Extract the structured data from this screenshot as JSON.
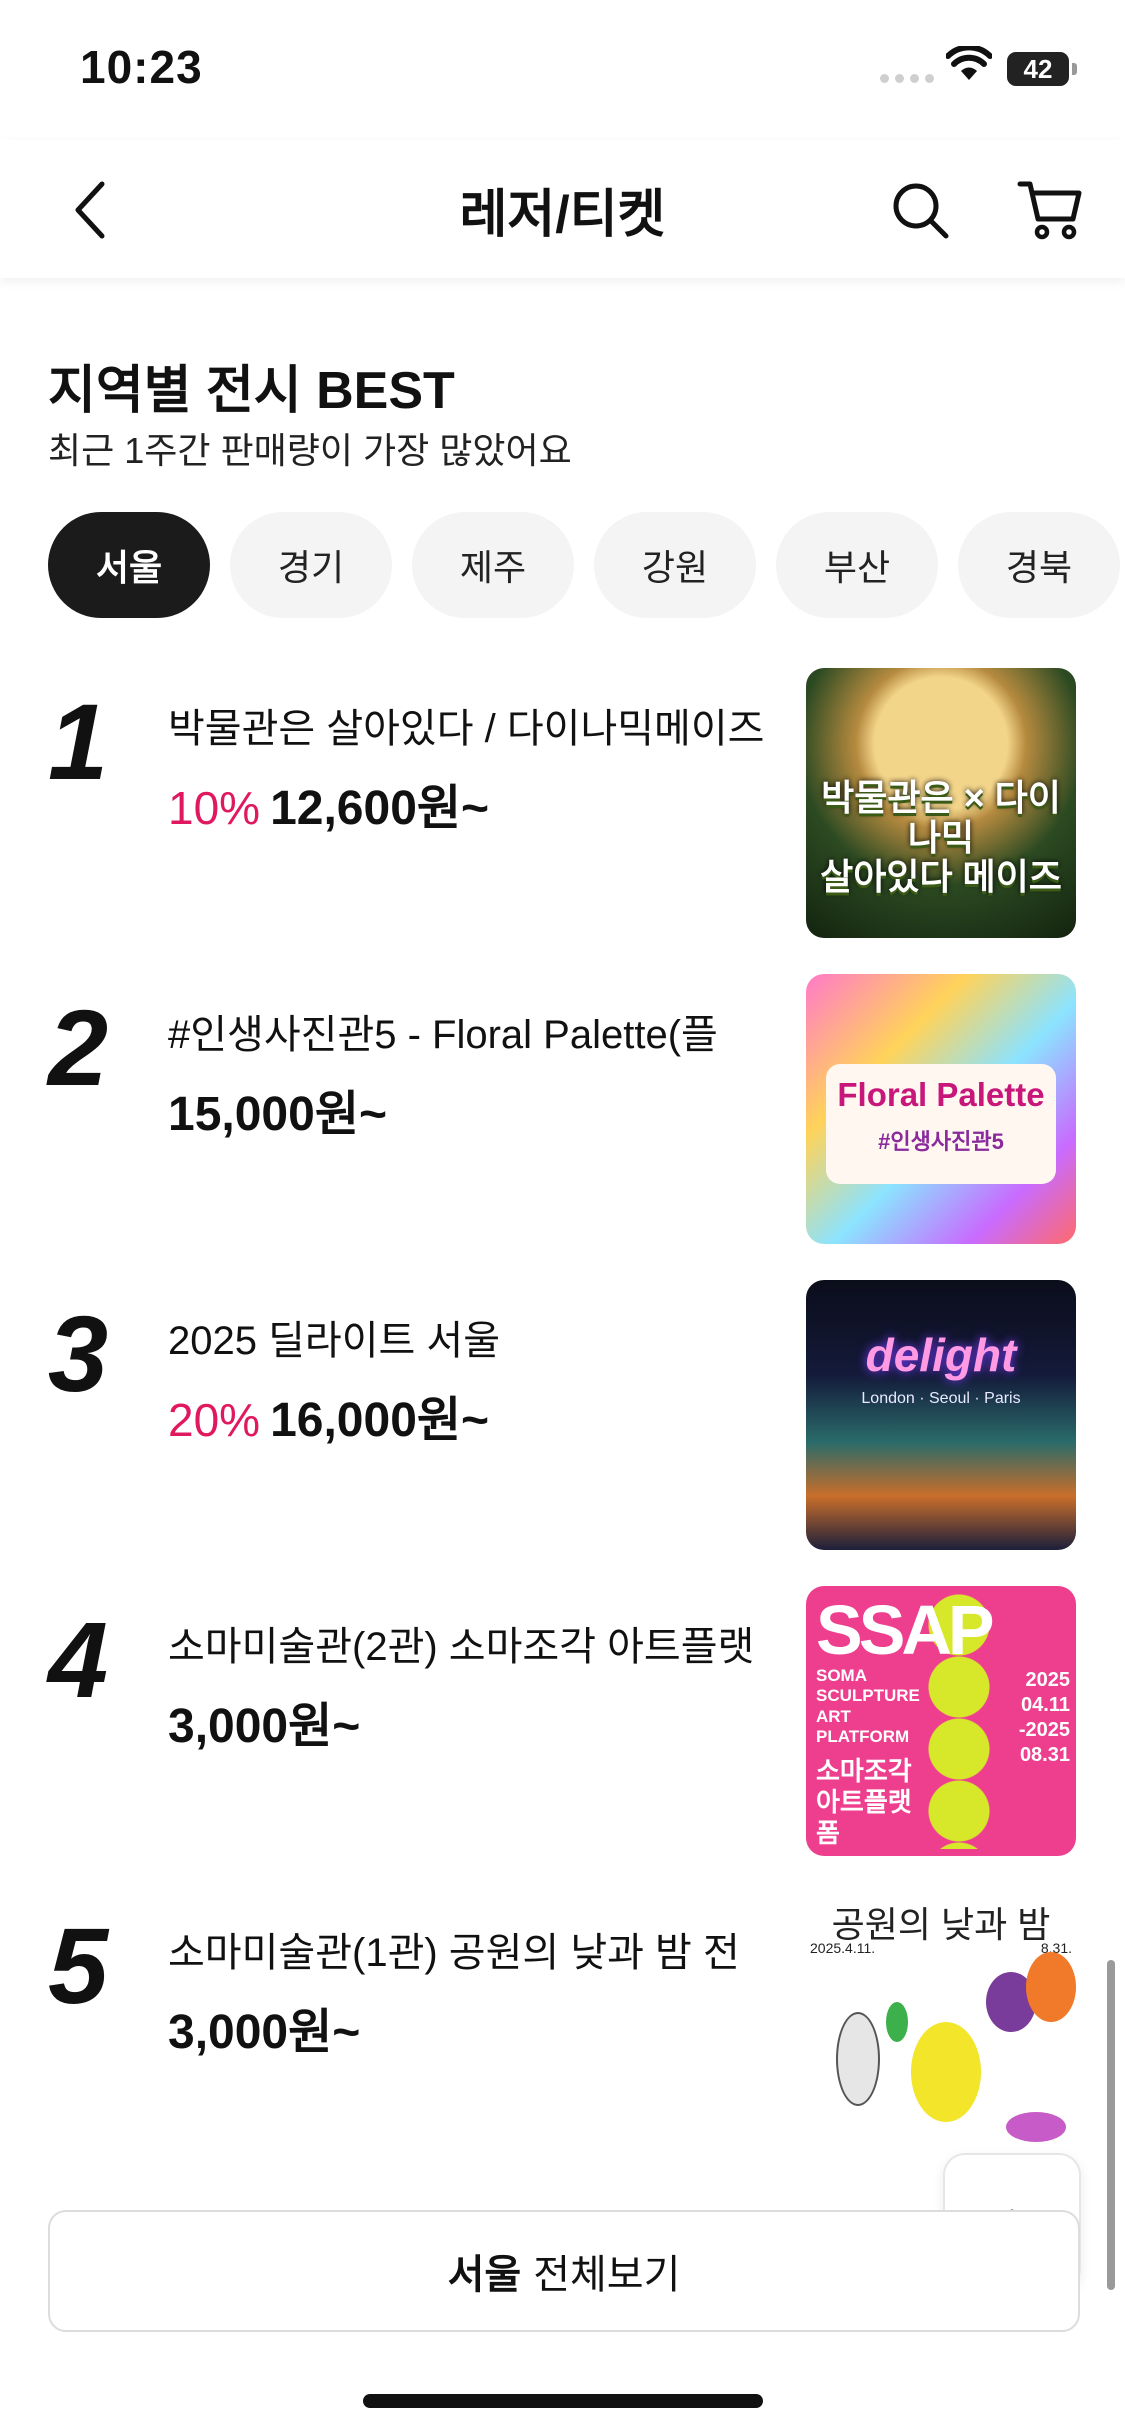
{
  "status_bar": {
    "time": "10:23",
    "battery": "42"
  },
  "navbar": {
    "title": "레저/티켓"
  },
  "section": {
    "title": "지역별 전시 BEST",
    "subtitle": "최근 1주간 판매량이 가장 많았어요"
  },
  "regions": [
    "서울",
    "경기",
    "제주",
    "강원",
    "부산",
    "경북"
  ],
  "active_region": "서울",
  "items": [
    {
      "rank": "1",
      "name": "박물관은 살아있다 / 다이나믹메이즈",
      "discount": "10%",
      "price": "12,600원~",
      "thumb_text": "박물관은 × 다이나믹\n살아있다 메이즈"
    },
    {
      "rank": "2",
      "name": "#인생사진관5 - Floral Palette(플",
      "discount": "",
      "price": "15,000원~",
      "thumb_text": "Floral Palette",
      "thumb_sub": "#인생사진관5"
    },
    {
      "rank": "3",
      "name": "2025 딜라이트 서울",
      "discount": "20%",
      "price": "16,000원~",
      "thumb_text": "delight",
      "thumb_sub": "London · Seoul · Paris"
    },
    {
      "rank": "4",
      "name": "소마미술관(2관) 소마조각 아트플랫",
      "discount": "",
      "price": "3,000원~",
      "thumb_text": "SSAP",
      "thumb_sub": "SOMA SCULPTURE ART PLATFORM",
      "thumb_date": "2025 04.11 -2025 08.31",
      "thumb_kr": "소마조각 아트플랫폼"
    },
    {
      "rank": "5",
      "name": "소마미술관(1관) 공원의 낮과 밤 전",
      "discount": "",
      "price": "3,000원~",
      "thumb_text": "공원의 낮과 밤",
      "thumb_date_start": "2025.4.11.",
      "thumb_date_end": "8.31."
    }
  ],
  "view_all": {
    "region": "서울",
    "label": "전체보기"
  }
}
